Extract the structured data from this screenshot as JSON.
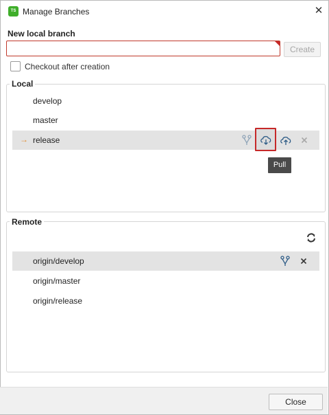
{
  "window": {
    "title": "Manage Branches",
    "app_icon": "TS"
  },
  "new_branch": {
    "label": "New local branch",
    "value": "",
    "placeholder": "",
    "create_label": "Create",
    "checkout_label": "Checkout after creation",
    "checkout_checked": false
  },
  "local": {
    "title": "Local",
    "items": [
      {
        "label": "develop",
        "current": false
      },
      {
        "label": "master",
        "current": false
      },
      {
        "label": "release",
        "current": true,
        "arrow": "→"
      }
    ],
    "tooltip": "Pull"
  },
  "remote": {
    "title": "Remote",
    "items": [
      {
        "label": "origin/develop"
      },
      {
        "label": "origin/master"
      },
      {
        "label": "origin/release"
      }
    ]
  },
  "footer": {
    "close_label": "Close"
  },
  "colors": {
    "error_border": "#c62828",
    "selected_row": "#e3e3e3",
    "current_arrow": "#e08a2b",
    "icon_blue": "#2d5b86"
  },
  "icons": {
    "close": "close-icon",
    "merge": "merge-icon",
    "pull": "cloud-download-icon",
    "push": "cloud-upload-icon",
    "delete": "delete-icon",
    "refresh": "refresh-icon"
  }
}
